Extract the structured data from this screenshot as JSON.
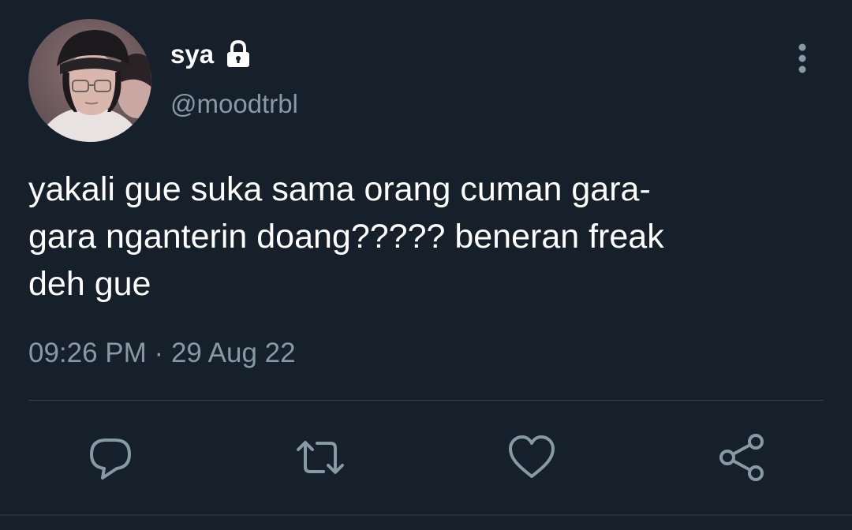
{
  "tweet": {
    "display_name": "sya",
    "handle": "@moodtrbl",
    "text": "yakali gue suka sama orang cuman gara-\ngara nganterin doang????? beneran freak\ndeh gue",
    "time": "09:26 PM",
    "separator": "·",
    "date": "29 Aug 22",
    "protected_icon": "lock-icon",
    "more_icon": "more-vertical-icon"
  },
  "actions": [
    {
      "name": "reply",
      "icon": "reply-icon"
    },
    {
      "name": "retweet",
      "icon": "retweet-icon"
    },
    {
      "name": "like",
      "icon": "heart-icon"
    },
    {
      "name": "share",
      "icon": "share-icon"
    }
  ],
  "colors": {
    "background": "#15202b",
    "text_primary": "#ffffff",
    "text_secondary": "#8899a6",
    "divider": "#38444d"
  }
}
